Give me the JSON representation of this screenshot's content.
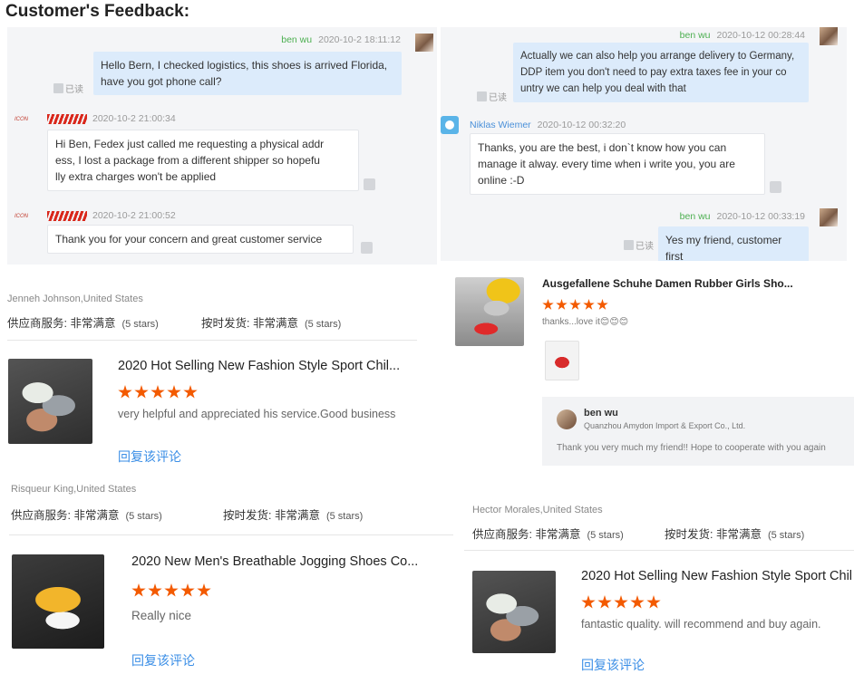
{
  "header": {
    "title": "Customer's Feedback:"
  },
  "chat_left": {
    "messages": [
      {
        "sender": "ben wu",
        "time": "2020-10-2 18:11:12",
        "lines": [
          "Hello Bern, I checked logistics, this shoes is arrived Florida,",
          "have you got phone call?"
        ],
        "read": "已读"
      },
      {
        "sender_logo": "company",
        "time": "2020-10-2 21:00:34",
        "lines": [
          "Hi Ben, Fedex just called me requesting a physical addr",
          "ess,  I lost a package from a different shipper so hopefu",
          "lly extra charges won't be applied"
        ]
      },
      {
        "sender_logo": "company",
        "time": "2020-10-2 21:00:52",
        "lines": [
          "Thank you for your concern and great customer service"
        ]
      }
    ]
  },
  "chat_right": {
    "messages": [
      {
        "sender": "ben wu",
        "time": "2020-10-12 00:28:44",
        "lines": [
          "Actually we can also help you arrange delivery to Germany,",
          "DDP item you don't need to pay extra taxes fee in your co",
          "untry we can help you deal with that"
        ],
        "read": "已读"
      },
      {
        "sender": "Niklas Wiemer",
        "time": "2020-10-12 00:32:20",
        "lines": [
          "Thanks, you are the best, i don`t know how you can",
          "manage it alway. every time when i write you, you are",
          "online :-D"
        ]
      },
      {
        "sender": "ben wu",
        "time": "2020-10-12 00:33:19",
        "lines": [
          "Yes my friend, customer first"
        ],
        "read": "已读"
      }
    ]
  },
  "reviews": {
    "r1": {
      "reviewer": "Jenneh Johnson,United States",
      "service_label": "供应商服务:",
      "service_value": "非常满意",
      "service_stars": "(5 stars)",
      "ship_label": "按时发货:",
      "ship_value": "非常满意",
      "ship_stars": "(5 stars)"
    },
    "p1": {
      "title": "2020 Hot Selling New Fashion Style Sport Chil...",
      "rating": 5,
      "comment": "very helpful and appreciated his service.Good business",
      "reply": "回复该评论"
    },
    "r2": {
      "reviewer": "Risqueur King,United States",
      "service_label": "供应商服务:",
      "service_value": "非常满意",
      "service_stars": "(5 stars)",
      "ship_label": "按时发货:",
      "ship_value": "非常满意",
      "ship_stars": "(5 stars)"
    },
    "p2": {
      "title": "2020 New Men's Breathable Jogging Shoes Co...",
      "rating": 5,
      "comment": "Really nice",
      "reply": "回复该评论"
    },
    "p3": {
      "title": "Ausgefallene Schuhe Damen Rubber Girls Sho...",
      "rating": 5,
      "comment": "thanks...love it😊😊😊"
    },
    "seller_reply": {
      "name": "ben wu",
      "company": "Quanzhou Amydon Import & Export Co., Ltd.",
      "text": "Thank you very much my friend!! Hope to cooperate with you again"
    },
    "r3": {
      "reviewer": "Hector Morales,United States",
      "service_label": "供应商服务:",
      "service_value": "非常满意",
      "service_stars": "(5 stars)",
      "ship_label": "按时发货:",
      "ship_value": "非常满意",
      "ship_stars": "(5 stars)"
    },
    "p4": {
      "title": "2020 Hot Selling New Fashion Style Sport Chil",
      "rating": 5,
      "comment": "fantastic quality. will recommend and buy again.",
      "reply": "回复该评论"
    }
  },
  "colors": {
    "star": "#f35a00",
    "link": "#3a8ee6",
    "sender_green": "#4caf50",
    "bubble_out": "#dcebfb"
  }
}
